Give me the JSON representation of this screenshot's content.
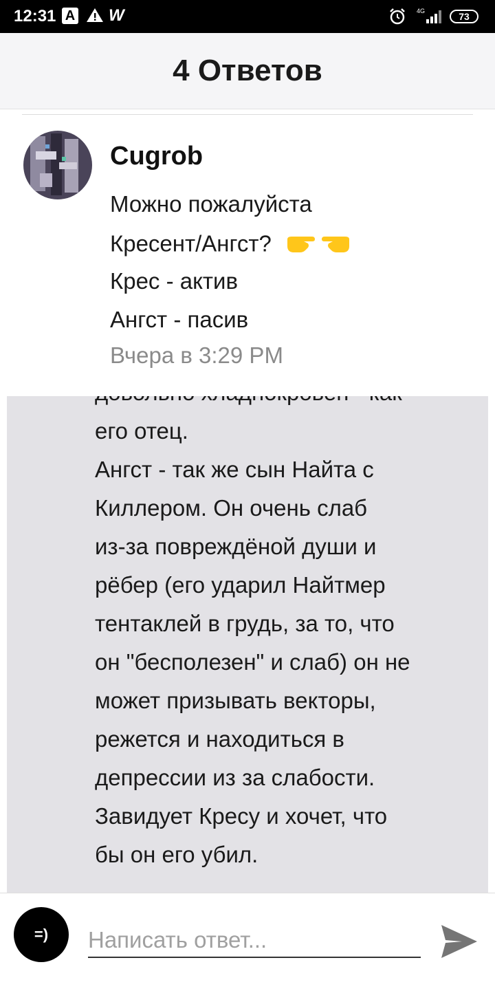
{
  "status_bar": {
    "time": "12:31",
    "network": "4G",
    "battery": "73"
  },
  "header": {
    "title": "4 Ответов"
  },
  "comment": {
    "username": "Cugrob",
    "lines": [
      "Можно пожалуйста",
      "Кресент/Ангст?",
      "Крес - актив",
      "Ангст - пасив"
    ],
    "emoji": "👉👈",
    "timestamp": "Вчера в 3:29 PM"
  },
  "reply": {
    "lines": [
      "довольно хладнокровен - как",
      "его отец.",
      "Ангст - так же сын Найта с",
      "Киллером. Он очень слаб",
      "из-за повреждёной  души и",
      "рёбер (его ударил Найтмер",
      "тентаклей в грудь, за то, что",
      "он \"бесполезен\" и слаб) он не",
      "может призывать векторы,",
      "режется  и находиться в",
      "депрессии из за слабости.",
      "Завидует Кресу и хочет, что",
      "бы он его убил."
    ]
  },
  "composer": {
    "emoji_button_label": "=)",
    "placeholder": "Написать ответ...",
    "send_icon": "send-icon"
  },
  "colors": {
    "status_bar": "#000000",
    "header_bg": "#f5f5f7",
    "panel_bg": "#e3e2e6",
    "timestamp": "#8a8a8a"
  }
}
